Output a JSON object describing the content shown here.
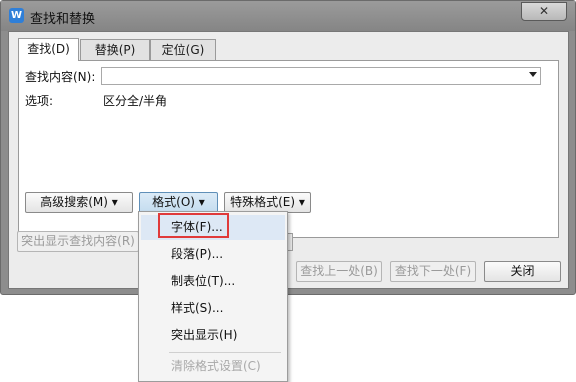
{
  "window": {
    "title": "查找和替换",
    "close_label": "✕"
  },
  "tabs": [
    {
      "label": "查找(D)",
      "active": true
    },
    {
      "label": "替换(P)",
      "active": false
    },
    {
      "label": "定位(G)",
      "active": false
    }
  ],
  "find": {
    "label": "查找内容(N):",
    "value": "",
    "options_label": "选项:",
    "options_value": "区分全/半角"
  },
  "buttons": {
    "advanced_search": "高级搜索(M) ▾",
    "format": "格式(O) ▾",
    "special_format": "特殊格式(E) ▾",
    "highlight_find": "突出显示查找内容(R)",
    "find_prev": "查找上一处(B)",
    "find_next": "查找下一处(F)",
    "close": "关闭"
  },
  "format_menu": [
    {
      "label": "字体(F)...",
      "enabled": true,
      "highlighted": true
    },
    {
      "label": "段落(P)...",
      "enabled": true
    },
    {
      "label": "制表位(T)...",
      "enabled": true
    },
    {
      "label": "样式(S)...",
      "enabled": true
    },
    {
      "label": "突出显示(H)",
      "enabled": true
    },
    {
      "label": "清除格式设置(C)",
      "enabled": false
    }
  ],
  "colors": {
    "accent": "#2f7fd8",
    "highlight_box": "#e03a3a",
    "menu_hover": "#dde8f5"
  },
  "icons": {
    "app": "wps-writer-icon",
    "close": "close-icon"
  }
}
